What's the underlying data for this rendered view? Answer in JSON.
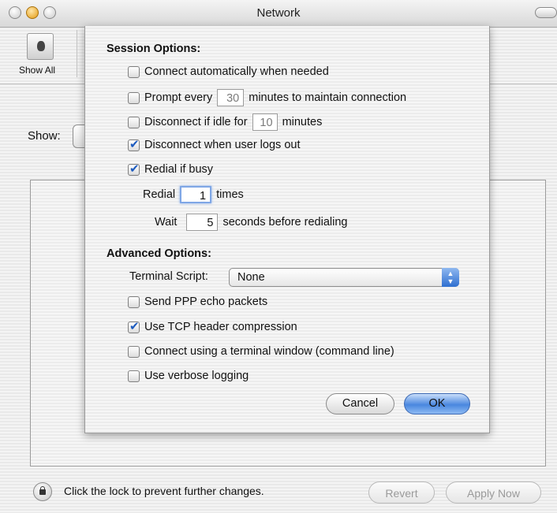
{
  "window": {
    "title": "Network"
  },
  "toolbar": {
    "show_all_label": "Show All"
  },
  "background": {
    "show_label": "Show:",
    "lock_text": "Click the lock to prevent further changes.",
    "revert_label": "Revert",
    "apply_label": "Apply Now"
  },
  "sheet": {
    "session_heading": "Session Options:",
    "connect_auto": {
      "label": "Connect automatically when needed",
      "checked": false
    },
    "prompt": {
      "label_before": "Prompt every",
      "value": "30",
      "label_after": "minutes to maintain connection",
      "checked": false
    },
    "disconnect_idle": {
      "label_before": "Disconnect if idle for",
      "value": "10",
      "label_after": "minutes",
      "checked": false
    },
    "disconnect_logout": {
      "label": "Disconnect when user logs out",
      "checked": true
    },
    "redial": {
      "label": "Redial if busy",
      "checked": true
    },
    "redial_times": {
      "label_before": "Redial",
      "value": "1",
      "label_after": "times"
    },
    "wait": {
      "label_before": "Wait",
      "value": "5",
      "label_after": "seconds before redialing"
    },
    "advanced_heading": "Advanced Options:",
    "terminal_script": {
      "label": "Terminal Script:",
      "value": "None"
    },
    "ppp_echo": {
      "label": "Send PPP echo packets",
      "checked": false
    },
    "tcp_compression": {
      "label": "Use TCP header compression",
      "checked": true
    },
    "terminal_window": {
      "label": "Connect using a terminal window (command line)",
      "checked": false
    },
    "verbose": {
      "label": "Use verbose logging",
      "checked": false
    },
    "cancel_label": "Cancel",
    "ok_label": "OK"
  }
}
